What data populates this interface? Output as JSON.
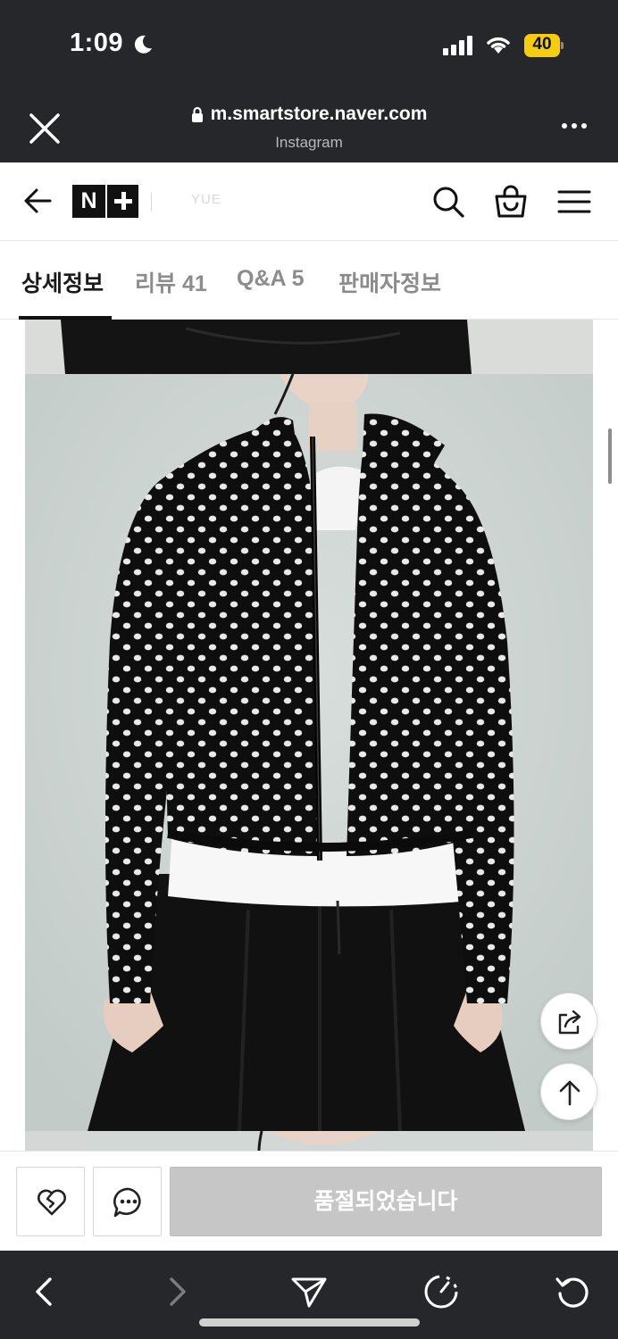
{
  "status_bar": {
    "time": "1:09",
    "battery": "40"
  },
  "browser": {
    "url": "m.smartstore.naver.com",
    "source": "Instagram"
  },
  "store": {
    "name": "YUE"
  },
  "tabs": [
    {
      "label": "상세정보"
    },
    {
      "label": "리뷰 41"
    },
    {
      "label": "Q&A 5"
    },
    {
      "label": "판매자정보"
    }
  ],
  "purchase": {
    "soldout_label": "품절되었습니다"
  },
  "icons": {
    "close": "close-icon",
    "lock": "lock-icon",
    "more": "more-icon",
    "back": "back-arrow-icon",
    "search": "search-icon",
    "cart": "shopping-bag-icon",
    "menu": "menu-icon",
    "share": "share-icon",
    "top": "arrow-up-icon",
    "like": "heart-icon",
    "chat": "chat-icon"
  },
  "colors": {
    "chrome": "#25272b",
    "soldout": "#c6c6c6",
    "accent": "#111111"
  }
}
